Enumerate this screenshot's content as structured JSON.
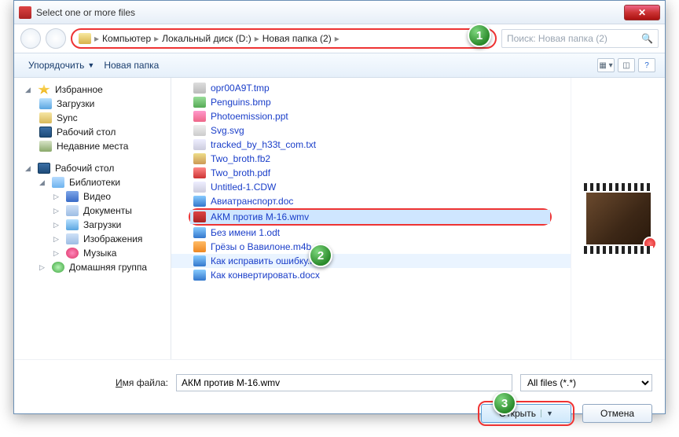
{
  "window": {
    "title": "Select one or more files"
  },
  "breadcrumb": {
    "root": "Компьютер",
    "drive": "Локальный диск (D:)",
    "folder": "Новая папка (2)"
  },
  "search": {
    "placeholder": "Поиск: Новая папка (2)"
  },
  "toolbar": {
    "organize": "Упорядочить",
    "newfolder": "Новая папка"
  },
  "sidebar": {
    "fav": "Избранное",
    "downloads": "Загрузки",
    "sync": "Sync",
    "desktop": "Рабочий стол",
    "recent": "Недавние места",
    "desktop2": "Рабочий стол",
    "libs": "Библиотеки",
    "video": "Видео",
    "docs": "Документы",
    "downloads2": "Загрузки",
    "images": "Изображения",
    "music": "Музыка",
    "homegroup": "Домашняя группа"
  },
  "files": {
    "f0": "opr00A9T.tmp",
    "f1": "Penguins.bmp",
    "f2": "Photoemission.ppt",
    "f3": "Svg.svg",
    "f4": "tracked_by_h33t_com.txt",
    "f5": "Two_broth.fb2",
    "f6": "Two_broth.pdf",
    "f7": "Untitled-1.CDW",
    "f8": "Авиатранспорт.doc",
    "f9": "АКМ против М-16.wmv",
    "f10": "Без имени 1.odt",
    "f11": "Грёзы о Вавилоне.m4b",
    "f12": "Как исправить ошибку.mht",
    "f13": "Как конвертировать.docx"
  },
  "footer": {
    "filename_label_pre": "И",
    "filename_label_rest": "мя файла:",
    "filename_value": "АКМ против М-16.wmv",
    "filter": "All files (*.*)",
    "open": "Открыть",
    "cancel": "Отмена"
  },
  "callouts": {
    "c1": "1",
    "c2": "2",
    "c3": "3"
  }
}
